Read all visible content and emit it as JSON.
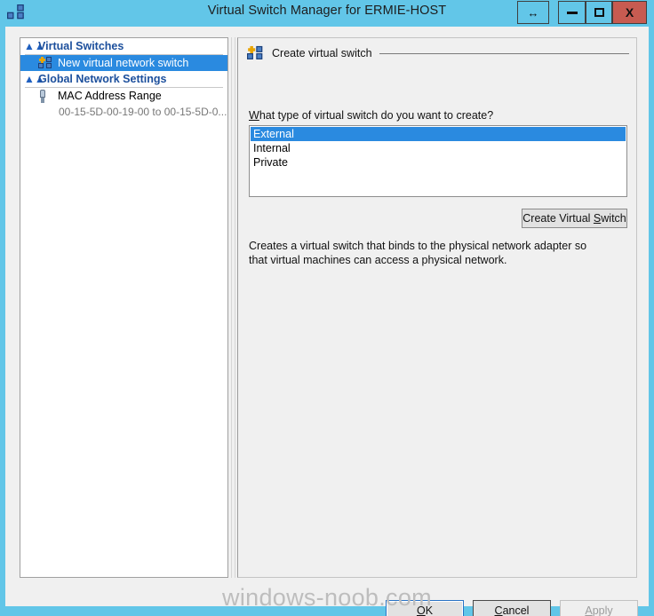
{
  "window": {
    "title": "Virtual Switch Manager for ERMIE-HOST",
    "icon": "virtual-switch-icon",
    "titlebar_color": "#62c6e8",
    "close_color": "#c75b51",
    "buttons": {
      "resize_label": "↔",
      "minimize_label": "",
      "maximize_label": "",
      "close_label": "X"
    }
  },
  "tree": {
    "groups": [
      {
        "label": "Virtual Switches",
        "chevron": "chevron-collapse-icon",
        "items": [
          {
            "label": "New virtual network switch",
            "icon": "new-virtual-switch-icon",
            "selected": true,
            "sub": null
          }
        ]
      },
      {
        "label": "Global Network Settings",
        "chevron": "chevron-collapse-icon",
        "items": [
          {
            "label": "MAC Address Range",
            "icon": "mac-address-icon",
            "selected": false,
            "sub": "00-15-5D-00-19-00 to 00-15-5D-0..."
          }
        ]
      }
    ],
    "selection_color": "#2a8ae0",
    "group_label_color": "#1c4f9c"
  },
  "content": {
    "section_title": "Create virtual switch",
    "section_icon": "new-virtual-switch-icon",
    "question_accel": "W",
    "question_rest": "hat type of virtual switch do you want to create?",
    "switch_types": [
      {
        "label": "External",
        "selected": true
      },
      {
        "label": "Internal",
        "selected": false
      },
      {
        "label": "Private",
        "selected": false
      }
    ],
    "create_button": {
      "prefix": "Create Virtual ",
      "accel": "S",
      "suffix": "witch"
    },
    "description": "Creates a virtual switch that binds to the physical network adapter so that virtual machines can access a physical network."
  },
  "footer": {
    "ok": {
      "prefix": "",
      "accel": "O",
      "suffix": "K",
      "default": true
    },
    "cancel": {
      "prefix": "",
      "accel": "C",
      "suffix": "ancel",
      "default": false
    },
    "apply": {
      "prefix": "",
      "accel": "A",
      "suffix": "pply",
      "disabled": true
    }
  },
  "watermark": "windows-noob.com"
}
